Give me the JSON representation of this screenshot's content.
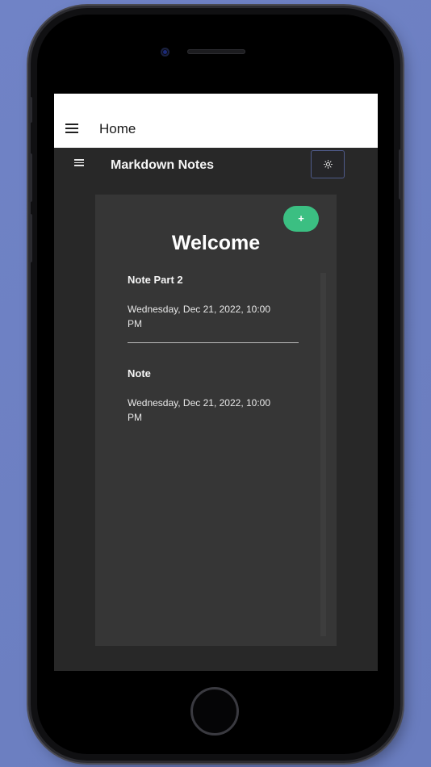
{
  "appbar": {
    "title": "Home"
  },
  "header": {
    "title": "Markdown Notes",
    "theme_toggle_icon": "sun-icon"
  },
  "main": {
    "add_button_label": "+",
    "heading": "Welcome",
    "notes": [
      {
        "title": "Note Part 2",
        "date": "Wednesday, Dec 21, 2022, 10:00 PM"
      },
      {
        "title": "Note",
        "date": "Wednesday, Dec 21, 2022, 10:00 PM"
      }
    ]
  },
  "colors": {
    "background": "#6f83c4",
    "screen": "#282828",
    "card": "#363636",
    "accent": "#3bbf82"
  }
}
